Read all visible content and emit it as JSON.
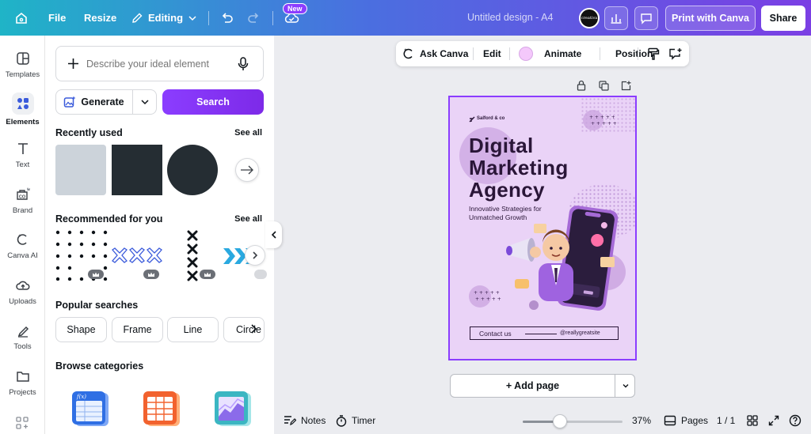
{
  "topbar": {
    "file_label": "File",
    "resize_label": "Resize",
    "editing_label": "Editing",
    "new_badge": "New",
    "doc_title": "Untitled design - A4",
    "avatar_text": "creativa",
    "print_label": "Print with Canva",
    "share_label": "Share"
  },
  "rail": {
    "items": [
      {
        "label": "Templates",
        "icon": "templates-icon"
      },
      {
        "label": "Elements",
        "icon": "elements-icon"
      },
      {
        "label": "Text",
        "icon": "text-icon"
      },
      {
        "label": "Brand",
        "icon": "brand-icon"
      },
      {
        "label": "Canva AI",
        "icon": "canva-ai-icon"
      },
      {
        "label": "Uploads",
        "icon": "uploads-icon"
      },
      {
        "label": "Tools",
        "icon": "tools-icon"
      },
      {
        "label": "Projects",
        "icon": "projects-icon"
      }
    ]
  },
  "panel": {
    "search_placeholder": "Describe your ideal element",
    "generate_label": "Generate",
    "search_label": "Search",
    "recently_used": "Recently used",
    "see_all": "See all",
    "recommended": "Recommended for you",
    "popular_searches": "Popular searches",
    "pills": [
      "Shape",
      "Frame",
      "Line",
      "Circle"
    ],
    "browse_categories": "Browse categories"
  },
  "context_toolbar": {
    "ask_canva": "Ask Canva",
    "edit": "Edit",
    "animate": "Animate",
    "position": "Position",
    "color": "#f4c8fb"
  },
  "design": {
    "brand": "Salford & co",
    "headline_1": "Digital",
    "headline_2": "Marketing",
    "headline_3": "Agency",
    "tagline_1": "Innovative Strategies for",
    "tagline_2": "Unmatched Growth",
    "contact": "Contact us",
    "handle": "@reallygreatsite",
    "background": "#ead3f7",
    "accent": "#8b3dff"
  },
  "canvas": {
    "add_page": "+ Add page"
  },
  "bottombar": {
    "notes": "Notes",
    "timer": "Timer",
    "zoom": "37%",
    "zoom_level": 0.37,
    "pages": "Pages",
    "page_count": "1 / 1"
  }
}
